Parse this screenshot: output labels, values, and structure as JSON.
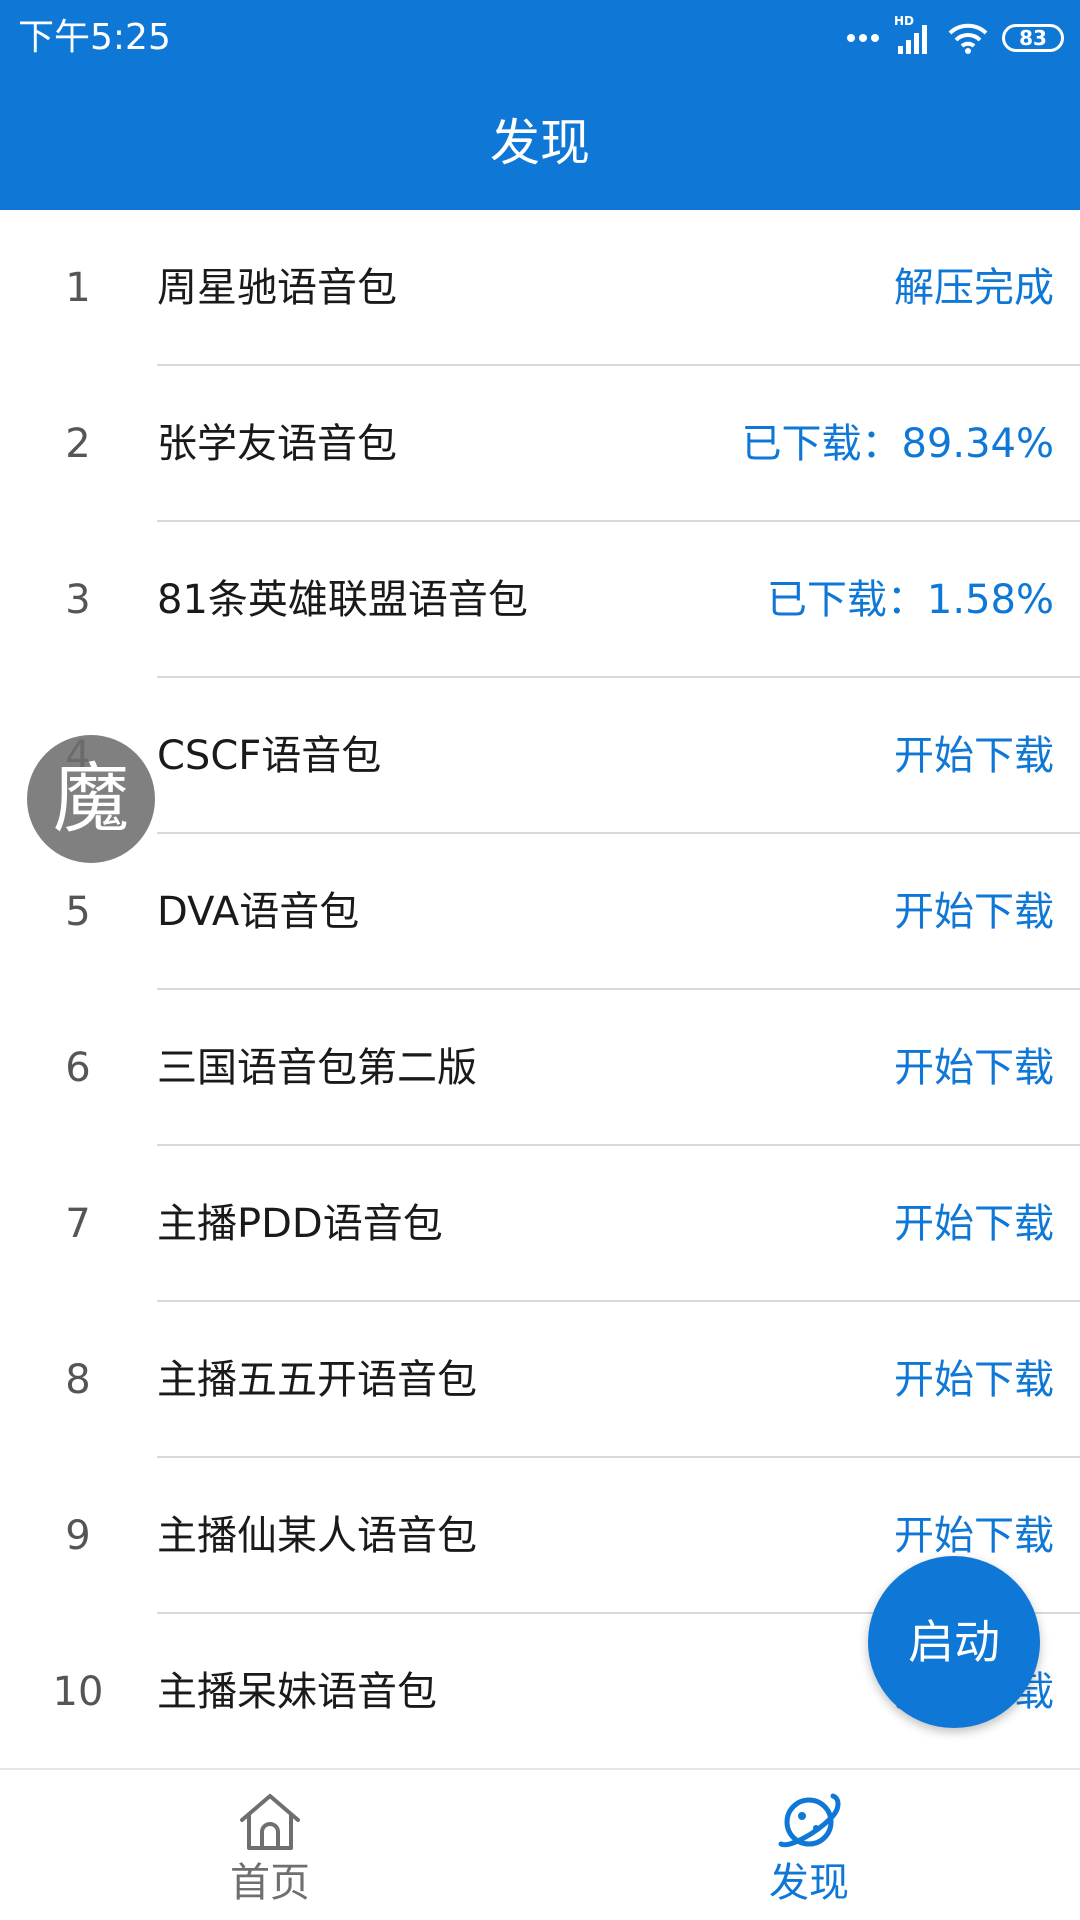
{
  "status_bar": {
    "time": "下午5:25",
    "network_badge": "HD",
    "battery_level": "83",
    "icons": [
      "dots-icon",
      "signal-icon",
      "wifi-icon",
      "battery-icon"
    ]
  },
  "header": {
    "title": "发现"
  },
  "items": [
    {
      "index": "1",
      "name": "周星驰语音包",
      "status": "解压完成"
    },
    {
      "index": "2",
      "name": "张学友语音包",
      "status": "已下载：89.34%"
    },
    {
      "index": "3",
      "name": "81条英雄联盟语音包",
      "status": "已下载：1.58%"
    },
    {
      "index": "4",
      "name": "CSCF语音包",
      "status": "开始下载"
    },
    {
      "index": "5",
      "name": "DVA语音包",
      "status": "开始下载"
    },
    {
      "index": "6",
      "name": "三国语音包第二版",
      "status": "开始下载"
    },
    {
      "index": "7",
      "name": "主播PDD语音包",
      "status": "开始下载"
    },
    {
      "index": "8",
      "name": "主播五五开语音包",
      "status": "开始下载"
    },
    {
      "index": "9",
      "name": "主播仙某人语音包",
      "status": "开始下载"
    },
    {
      "index": "10",
      "name": "主播呆妹语音包",
      "status": "开始下载"
    }
  ],
  "floating_button": {
    "label": "魔"
  },
  "fab": {
    "label": "启动"
  },
  "bottom_nav": [
    {
      "label": "首页",
      "icon": "home-icon",
      "active": false
    },
    {
      "label": "发现",
      "icon": "planet-icon",
      "active": true
    }
  ],
  "colors": {
    "primary": "#0f78d7",
    "divider": "#d9d9d9",
    "text": "#1a1a1a",
    "inactive": "#6f6f6f"
  }
}
